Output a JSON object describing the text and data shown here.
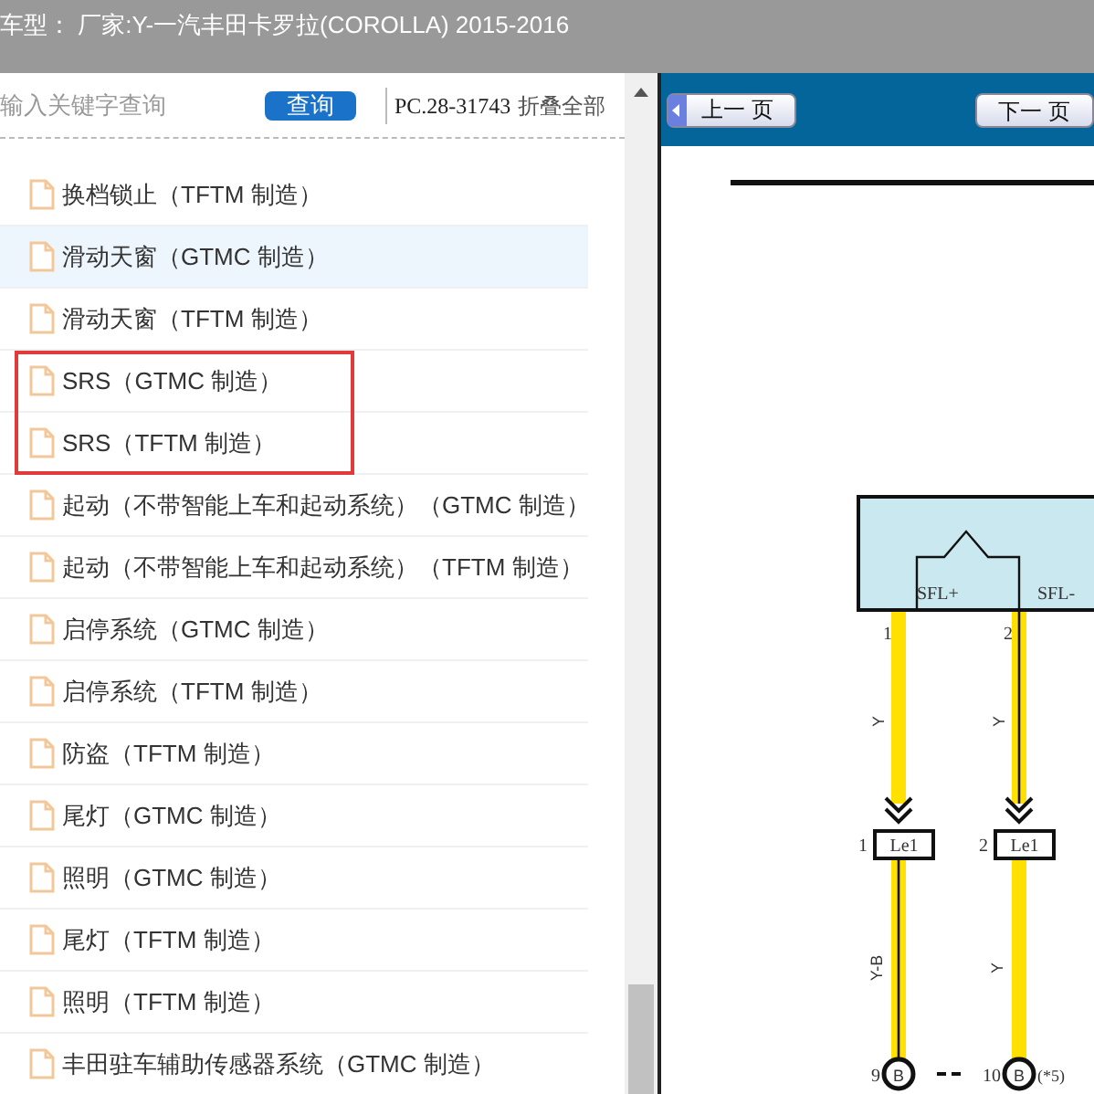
{
  "title_bar": {
    "title": "车型：  厂家:Y-一汽丰田卡罗拉(COROLLA) 2015-2016"
  },
  "search": {
    "placeholder": "输入关键字查询",
    "button": "查询",
    "code": "PC.28-31743",
    "collapse_all": "折叠全部"
  },
  "tree": {
    "items": [
      {
        "label": "换档锁止（TFTM 制造）",
        "selected": false,
        "outlined": false
      },
      {
        "label": "滑动天窗（GTMC 制造）",
        "selected": true,
        "outlined": false
      },
      {
        "label": "滑动天窗（TFTM 制造）",
        "selected": false,
        "outlined": false
      },
      {
        "label": "SRS（GTMC 制造）",
        "selected": false,
        "outlined": true
      },
      {
        "label": "SRS（TFTM 制造）",
        "selected": false,
        "outlined": true
      },
      {
        "label": "起动（不带智能上车和起动系统）（GTMC 制造）",
        "selected": false,
        "outlined": false
      },
      {
        "label": "起动（不带智能上车和起动系统）（TFTM 制造）",
        "selected": false,
        "outlined": false
      },
      {
        "label": "启停系统（GTMC 制造）",
        "selected": false,
        "outlined": false
      },
      {
        "label": "启停系统（TFTM 制造）",
        "selected": false,
        "outlined": false
      },
      {
        "label": "防盗（TFTM 制造）",
        "selected": false,
        "outlined": false
      },
      {
        "label": "尾灯（GTMC 制造）",
        "selected": false,
        "outlined": false
      },
      {
        "label": "照明（GTMC 制造）",
        "selected": false,
        "outlined": false
      },
      {
        "label": "尾灯（TFTM 制造）",
        "selected": false,
        "outlined": false
      },
      {
        "label": "照明（TFTM 制造）",
        "selected": false,
        "outlined": false
      },
      {
        "label": "丰田驻车辅助传感器系统（GTMC 制造）",
        "selected": false,
        "outlined": false
      }
    ]
  },
  "viewer": {
    "prev_button": "上一 页",
    "next_button": "下一 页",
    "diagram": {
      "pins": [
        "SFL+",
        "SFL-"
      ],
      "wires": [
        {
          "pin_no": "1",
          "color_code": "Y",
          "connector_no": "1",
          "connector": "Le1",
          "lower_color_code": "Y-B",
          "terminal_no": "9",
          "terminal": "B"
        },
        {
          "pin_no": "2",
          "color_code": "Y",
          "connector_no": "2",
          "connector": "Le1",
          "lower_color_code": "Y",
          "terminal_no": "10",
          "terminal": "B"
        }
      ],
      "note": "(*5)"
    }
  }
}
